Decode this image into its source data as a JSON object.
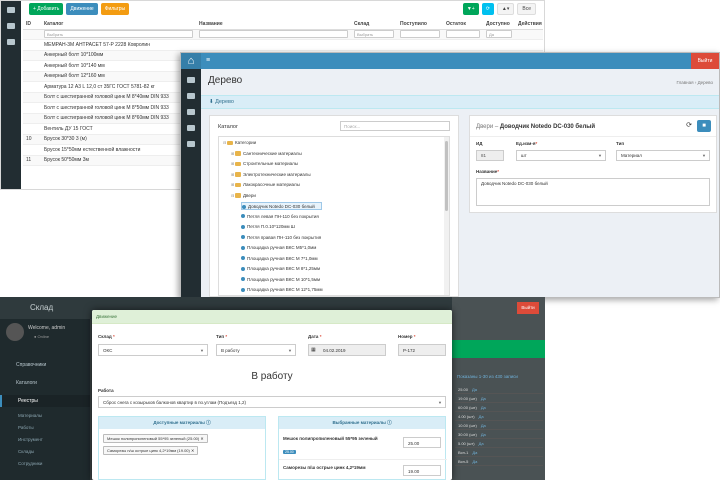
{
  "list_window": {
    "toolbar": {
      "add_label": "+ Добавить",
      "move_label": "Движение",
      "filters_label": "Фильтры"
    },
    "right_buttons": {
      "all_label": "Все"
    },
    "columns": [
      "ID",
      "Каталог",
      "Название",
      "Склад",
      "Поступило",
      "Остаток",
      "Доступно",
      "Действия"
    ],
    "filter_placeholders": {
      "catalog": "Выбрать",
      "warehouse": "Выбрать",
      "available": "Да"
    },
    "rows": [
      {
        "id": "",
        "name": "МЕМРАН-3М АНТРАСЕТ 57-Р 2228 Ковролин"
      },
      {
        "id": "",
        "name": "Анкерный болт 10*100мм"
      },
      {
        "id": "",
        "name": "Анкерный болт 10*140 мм"
      },
      {
        "id": "",
        "name": "Анкерный болт 12*160 мм"
      },
      {
        "id": "",
        "name": "Арматура 12 А3 L 12,0 ст 35ГС ГОСТ 5781-82 кг"
      },
      {
        "id": "",
        "name": "Болт с шестигранной головой цинк М 8*40мм DIN 933"
      },
      {
        "id": "",
        "name": "Болт с шестигранной головой цинк М 8*50мм DIN 933"
      },
      {
        "id": "",
        "name": "Болт с шестигранной головой цинк М 8*60мм DIN 933"
      },
      {
        "id": "",
        "name": "Вентиль ДУ 15 ГОСТ"
      },
      {
        "id": "10",
        "name": "Брусок 30*30 3 (м)"
      },
      {
        "id": "",
        "name": "Брусок 15*50мм естественной влажности"
      },
      {
        "id": "11",
        "name": "Брусок 50*50мм 3м"
      }
    ]
  },
  "tree_window": {
    "logout_label": "Выйти",
    "page_title": "Дерево",
    "breadcrumb": "Главная › Дерево",
    "section_title": "Дерево",
    "tree_label": "Каталог",
    "tree_search_placeholder": "Поиск...",
    "root_label": "Категории",
    "folders": [
      "Сантехнические материалы",
      "Строительные материалы",
      "Электротехнические материалы",
      "Лакокрасочные материалы",
      "Двери"
    ],
    "items": [
      "Доводчик Notedo DC-030 белый",
      "Петля левая ПН-110 без покрытия",
      "Петля П.0.10*120мм Ш",
      "Петля правая ПН-110 без покрытия",
      "Площадка ручная ВКС М5*1,0мм",
      "Площадка ручная ВКС М 7*1,0мм",
      "Площадка ручная ВКС М 8*1,25мм",
      "Площадка ручная ВКС М 10*1,5мм",
      "Площадка ручная ВКС М 12*1,75мм"
    ],
    "selected_index": 0,
    "detail": {
      "prefix": "Двери",
      "title": "Доводчик Notedo DC-030 белый",
      "id_label": "ИД",
      "id_value": "81",
      "unit_label": "Ед.изм-я",
      "unit_value": "шт",
      "type_label": "Тип",
      "type_value": "Материал",
      "name_label": "Название",
      "name_value": "Доводчик Notedo DC-030 белый"
    }
  },
  "admin_window": {
    "brand": "Склад",
    "user_name": "Welcome, admin",
    "user_status": "● Online",
    "nav": [
      {
        "label": "Справочники"
      },
      {
        "label": "Каталоги"
      },
      {
        "label": "Реестры"
      }
    ],
    "subnav": [
      "Материалы",
      "Работы",
      "Инструмент",
      "Склады",
      "Сотрудники"
    ],
    "exit_label": "Выйти",
    "info_text": "Показаны 1-30 из 430 записи",
    "side_rows": [
      {
        "a": "25.00",
        "b": "Да"
      },
      {
        "a": "19.00 (шт)",
        "b": "Да"
      },
      {
        "a": "60.00 (шт)",
        "b": "Да"
      },
      {
        "a": "4.00 (шт)",
        "b": "Да"
      },
      {
        "a": "10.00 (шт)",
        "b": "Да"
      },
      {
        "a": "30.00 (шт)",
        "b": "Да"
      },
      {
        "a": "5.00 (шт)",
        "b": "Да"
      },
      {
        "a": "Всп-1",
        "b": "Да"
      },
      {
        "a": "Всп-5",
        "b": "Да"
      }
    ]
  },
  "modal": {
    "header": "Движение",
    "warehouse_label": "Склад",
    "warehouse_value": "ОКС",
    "type_label": "Тип",
    "type_value": "В работу",
    "date_label": "Дата",
    "date_value": "04.02.2019",
    "number_label": "Номер",
    "number_value": "Р-172",
    "title": "В работу",
    "work_label": "Работа",
    "work_value": "Сброс снега с козырьков балконов квартир в по.углам (Подъезд 1,2)",
    "available_title": "Доступные материалы",
    "selected_title": "Выбранные материалы",
    "available_items": [
      "Мешок полипропиленовый 55*95 зеленый (25.00) ✕",
      "Саморезы п/ш острые цинк 4,2*19мм (19.00) ✕"
    ],
    "selected_items": [
      {
        "name": "Мешок полипропиленовый 55*95 зеленый",
        "badge": "25.00",
        "qty": "25.00"
      },
      {
        "name": "Саморезы п/ш острые цинк 4,2*19мм",
        "badge": "",
        "qty": "19.00"
      }
    ]
  },
  "colors": {
    "accent": "#3c8dbc",
    "success": "#00a65a",
    "danger": "#dd4b39",
    "warning": "#f39c12",
    "sidebar": "#222d32"
  }
}
